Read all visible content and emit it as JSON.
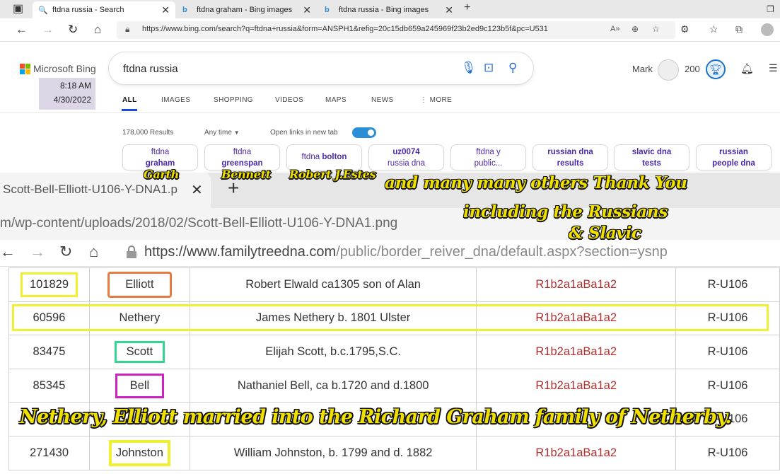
{
  "browser": {
    "tabs": [
      {
        "title": "ftdna russia - Search"
      },
      {
        "title": "ftdna graham - Bing images"
      },
      {
        "title": "ftdna russia - Bing images"
      }
    ],
    "url": "https://www.bing.com/search?q=ftdna+russia&form=ANSPH1&refig=20c15db659a245969f23b2ed9c123b5f&pc=U531"
  },
  "bing": {
    "logo": "Microsoft Bing",
    "time": "8:18 AM",
    "date": "4/30/2022",
    "query": "ftdna russia",
    "user_name": "Mark",
    "points": "200",
    "nav": [
      "ALL",
      "IMAGES",
      "SHOPPING",
      "VIDEOS",
      "MAPS",
      "NEWS",
      "MORE"
    ],
    "results_count": "178,000 Results",
    "time_filter": "Any time",
    "open_links": "Open links in new tab",
    "chips": [
      {
        "l1": "ftdna",
        "l2": "graham"
      },
      {
        "l1": "ftdna",
        "l2": "greenspan"
      },
      {
        "l1": "ftdna",
        "l2": "bolton"
      },
      {
        "l1": "uz0074",
        "l2": "russia dna"
      },
      {
        "l1": "ftdna y",
        "l2": "public..."
      },
      {
        "l1": "russian dna",
        "l2": "results"
      },
      {
        "l1": "slavic dna",
        "l2": "tests"
      },
      {
        "l1": "russian",
        "l2": "people dna"
      }
    ]
  },
  "annotations": {
    "garth": "Garth",
    "bennett": "Bennett",
    "estes": "Robert J.Estes",
    "thanks": "and many many others Thank You",
    "russians": "including the Russians",
    "slavic": "& Slavic",
    "bottom": "Nethery, Elliott married into the Richard Graham family of Netherby."
  },
  "second_browser": {
    "tab_title": "Scott-Bell-Elliott-U106-Y-DNA1.p",
    "file_url": "m/wp-content/uploads/2018/02/Scott-Bell-Elliott-U106-Y-DNA1.png",
    "site_url_domain": "https://www.familytreedna.com",
    "site_url_path": "/public/border_reiver_dna/default.aspx?section=ysnp"
  },
  "table": {
    "rows": [
      {
        "kit": "101829",
        "surname": "Elliott",
        "ancestor": "Robert Elwald ca1305 son of Alan",
        "haplogroup": "R1b2a1aBa1a2",
        "snp": "R-U106"
      },
      {
        "kit": "60596",
        "surname": "Nethery",
        "ancestor": "James Nethery b. 1801 Ulster",
        "haplogroup": "R1b2a1aBa1a2",
        "snp": "R-U106"
      },
      {
        "kit": "83475",
        "surname": "Scott",
        "ancestor": "Elijah Scott, b.c.1795,S.C.",
        "haplogroup": "R1b2a1aBa1a2",
        "snp": "R-U106"
      },
      {
        "kit": "85345",
        "surname": "Bell",
        "ancestor": "Nathaniel Bell, ca b.1720 and d.1800",
        "haplogroup": "R1b2a1aBa1a2",
        "snp": "R-U106"
      },
      {
        "kit": "",
        "surname": "",
        "ancestor": "",
        "haplogroup": "",
        "snp": "R-U106"
      },
      {
        "kit": "271430",
        "surname": "Johnston",
        "ancestor": "William Johnston, b. 1799 and d. 1882",
        "haplogroup": "R1b2a1aBa1a2",
        "snp": "R-U106"
      }
    ]
  },
  "colors": {
    "highlight_yellow": "#f0f030",
    "elliott_box": "#e87a40",
    "scott_box": "#30d890",
    "bell_box": "#d020c0",
    "annotation_gold": "#f0e000"
  }
}
